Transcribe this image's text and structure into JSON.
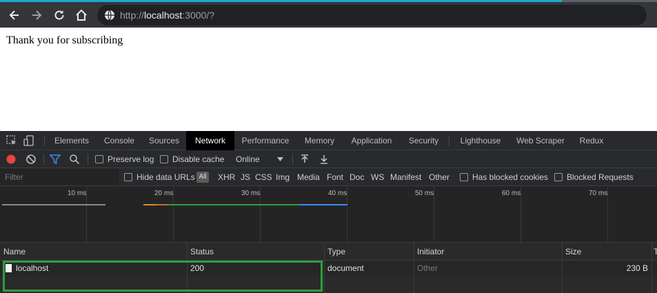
{
  "browser": {
    "url_scheme": "http://",
    "url_host": "localhost",
    "url_path": ":3000/?"
  },
  "page": {
    "message": "Thank you for subscribing"
  },
  "devtools": {
    "tabs": [
      "Elements",
      "Console",
      "Sources",
      "Network",
      "Performance",
      "Memory",
      "Application",
      "Security",
      "Lighthouse",
      "Web Scraper",
      "Redux"
    ],
    "active_tab": "Network",
    "toolbar": {
      "preserve_log": "Preserve log",
      "disable_cache": "Disable cache",
      "throttling": "Online"
    },
    "filter": {
      "placeholder": "Filter",
      "hide_data_urls": "Hide data URLs",
      "all": "All",
      "types": [
        "XHR",
        "JS",
        "CSS",
        "Img",
        "Media",
        "Font",
        "Doc",
        "WS",
        "Manifest",
        "Other"
      ],
      "has_blocked_cookies": "Has blocked cookies",
      "blocked_requests": "Blocked Requests"
    },
    "timeline": {
      "ticks": [
        "10 ms",
        "20 ms",
        "30 ms",
        "40 ms",
        "50 ms",
        "60 ms",
        "70 ms"
      ]
    },
    "table": {
      "columns": [
        "Name",
        "Status",
        "Type",
        "Initiator",
        "Size",
        "T"
      ],
      "rows": [
        {
          "name": "localhost",
          "status": "200",
          "type": "document",
          "initiator": "Other",
          "size": "230 B"
        }
      ]
    }
  },
  "colors": {
    "accent": "#1ea7d0",
    "record": "#e8453c",
    "filter_active": "#3d8af7",
    "highlight": "#2e9e3e"
  }
}
